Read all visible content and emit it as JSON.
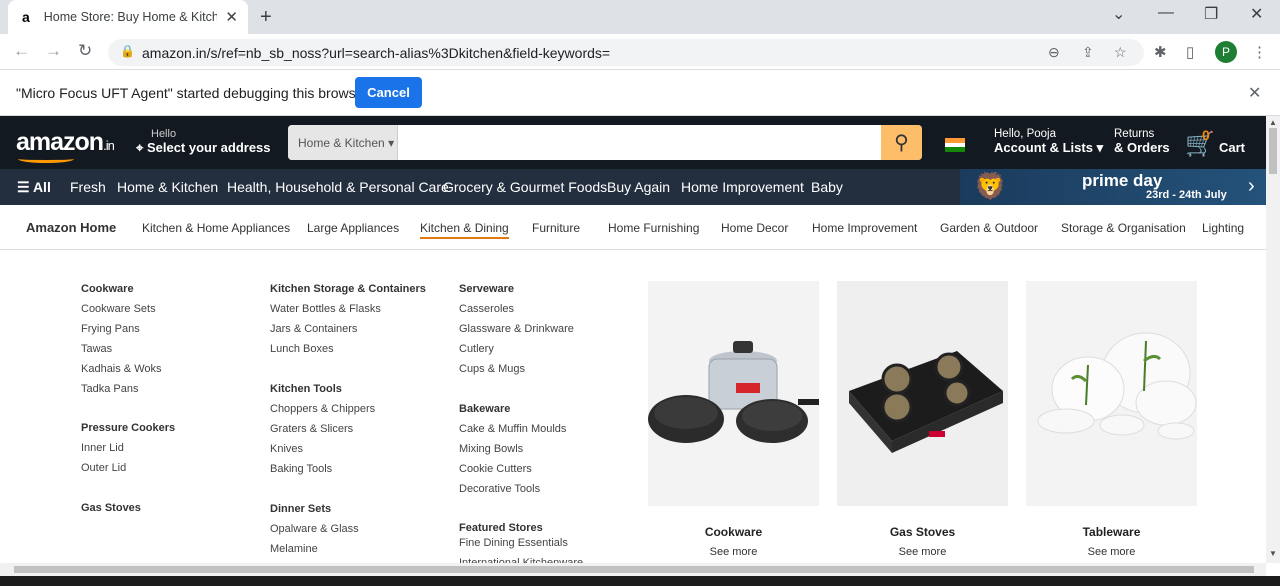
{
  "browser": {
    "tab_title": "Home Store: Buy Home & Kitchen",
    "url": "amazon.in/s/ref=nb_sb_noss?url=search-alias%3Dkitchen&field-keywords=",
    "profile_initial": "P"
  },
  "infobar": {
    "message": "\"Micro Focus UFT Agent\" started debugging this browser",
    "cancel_label": "Cancel"
  },
  "header": {
    "logo": "amazon",
    "logo_suffix": ".in",
    "address_hello": "Hello",
    "address_select": "Select your address",
    "search_category": "Home & Kitchen",
    "account_hello": "Hello, Pooja",
    "account_lists": "Account & Lists",
    "returns": "Returns",
    "orders": "& Orders",
    "cart_count": "0",
    "cart_label": "Cart"
  },
  "nav": {
    "all": "All",
    "items": [
      "Fresh",
      "Home & Kitchen",
      "Health, Household & Personal Care",
      "Grocery & Gourmet Foods",
      "Buy Again",
      "Home Improvement",
      "Baby"
    ],
    "promo_title": "prime day",
    "promo_dates": "23rd - 24th July"
  },
  "subnav": {
    "brand": "Amazon Home",
    "items": [
      "Kitchen & Home Appliances",
      "Large Appliances",
      "Kitchen & Dining",
      "Furniture",
      "Home Furnishing",
      "Home Decor",
      "Home Improvement",
      "Garden & Outdoor",
      "Storage & Organisation",
      "Lighting"
    ],
    "active": "Kitchen & Dining"
  },
  "menu": {
    "col1": {
      "cookware": "Cookware",
      "cookware_items": [
        "Cookware Sets",
        "Frying Pans",
        "Tawas",
        "Kadhais & Woks",
        "Tadka Pans"
      ],
      "pressure": "Pressure Cookers",
      "pressure_items": [
        "Inner Lid",
        "Outer Lid"
      ],
      "gas": "Gas Stoves"
    },
    "col2": {
      "storage": "Kitchen Storage & Containers",
      "storage_items": [
        "Water Bottles & Flasks",
        "Jars & Containers",
        "Lunch Boxes"
      ],
      "tools": "Kitchen Tools",
      "tools_items": [
        "Choppers & Chippers",
        "Graters & Slicers",
        "Knives",
        "Baking Tools"
      ],
      "dinner": "Dinner Sets",
      "dinner_items": [
        "Opalware & Glass",
        "Melamine"
      ]
    },
    "col3": {
      "serveware": "Serveware",
      "serveware_items": [
        "Casseroles",
        "Glassware & Drinkware",
        "Cutlery",
        "Cups & Mugs"
      ],
      "bakeware": "Bakeware",
      "bakeware_items": [
        "Cake & Muffin Moulds",
        "Mixing Bowls",
        "Cookie Cutters",
        "Decorative Tools"
      ],
      "featured": "Featured Stores",
      "featured_items": [
        "Fine Dining Essentials",
        "International Kitchenware"
      ]
    },
    "cards": [
      {
        "title": "Cookware",
        "more": "See more"
      },
      {
        "title": "Gas Stoves",
        "more": "See more"
      },
      {
        "title": "Tableware",
        "more": "See more"
      }
    ]
  }
}
